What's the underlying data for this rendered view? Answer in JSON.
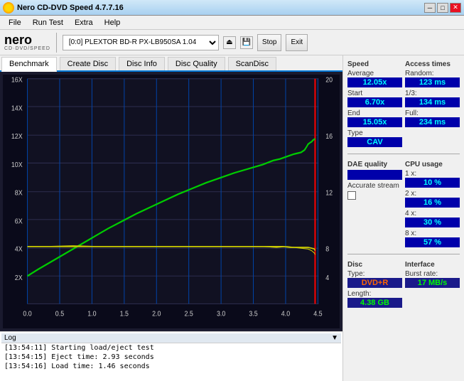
{
  "titleBar": {
    "icon": "disc-icon",
    "title": "Nero CD-DVD Speed 4.7.7.16",
    "minimize": "─",
    "maximize": "□",
    "close": "✕"
  },
  "menu": {
    "items": [
      "File",
      "Run Test",
      "Extra",
      "Help"
    ]
  },
  "toolbar": {
    "driveLabel": "[0:0]  PLEXTOR BD-R  PX-LB950SA 1.04",
    "stopButton": "Stop",
    "exitButton": "Exit"
  },
  "tabs": {
    "items": [
      "Benchmark",
      "Create Disc",
      "Disc Info",
      "Disc Quality",
      "ScanDisc"
    ],
    "active": 0
  },
  "chart": {
    "yAxisLabels": [
      "16X",
      "14X",
      "12X",
      "10X",
      "8X",
      "6X",
      "4X",
      "2X"
    ],
    "yAxisRight": [
      "20",
      "16",
      "12",
      "8",
      "4"
    ],
    "xAxisLabels": [
      "0.0",
      "0.5",
      "1.0",
      "1.5",
      "2.0",
      "2.5",
      "3.0",
      "3.5",
      "4.0",
      "4.5"
    ]
  },
  "stats": {
    "speed": {
      "title": "Speed",
      "averageLabel": "Average",
      "averageValue": "12.05x",
      "startLabel": "Start",
      "startValue": "6.70x",
      "endLabel": "End",
      "endValue": "15.05x",
      "typeLabel": "Type",
      "typeValue": "CAV"
    },
    "accessTimes": {
      "title": "Access times",
      "randomLabel": "Random:",
      "randomValue": "123 ms",
      "oneThirdLabel": "1/3:",
      "oneThirdValue": "134 ms",
      "fullLabel": "Full:",
      "fullValue": "234 ms"
    },
    "daeQuality": {
      "title": "DAE quality",
      "value": ""
    },
    "accurateStream": {
      "label": "Accurate stream",
      "checked": false
    },
    "cpu": {
      "title": "CPU usage",
      "1x": "10 %",
      "2x": "16 %",
      "4x": "30 %",
      "8x": "57 %"
    },
    "disc": {
      "title": "Disc",
      "typeLabel": "Type:",
      "typeValue": "DVD+R",
      "lengthLabel": "Length:",
      "lengthValue": "4.38 GB"
    },
    "interface": {
      "title": "Interface",
      "burstLabel": "Burst rate:",
      "burstValue": "17 MB/s"
    }
  },
  "log": {
    "entries": [
      "[13:54:11]  Starting load/eject test",
      "[13:54:15]  Eject time: 2.93 seconds",
      "[13:54:16]  Load time: 1.46 seconds"
    ]
  }
}
